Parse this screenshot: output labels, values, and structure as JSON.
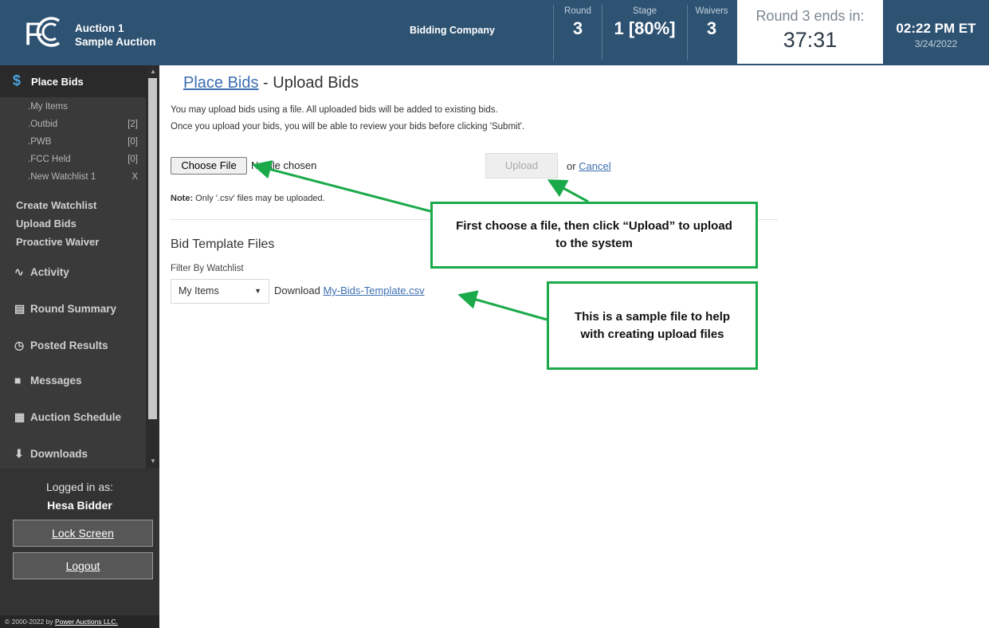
{
  "header": {
    "auction_line1": "Auction 1",
    "auction_line2": "Sample Auction",
    "company": "Bidding Company",
    "round_label": "Round",
    "round_value": "3",
    "stage_label": "Stage",
    "stage_value": "1 [80%]",
    "waivers_label": "Waivers",
    "waivers_value": "3",
    "timer_label": "Round 3 ends in:",
    "timer_value": "37:31",
    "clock_time": "02:22 PM ET",
    "clock_date": "3/24/2022"
  },
  "sidebar": {
    "place_bids": "Place Bids",
    "sub_items": [
      {
        "label": "My Items",
        "count": ""
      },
      {
        "label": "Outbid",
        "count": "[2]"
      },
      {
        "label": "PWB",
        "count": "[0]"
      },
      {
        "label": "FCC Held",
        "count": "[0]"
      },
      {
        "label": "New Watchlist 1",
        "count": "X"
      }
    ],
    "create_watchlist": "Create Watchlist",
    "upload_bids": "Upload Bids",
    "proactive_waiver": "Proactive Waiver",
    "nav": [
      "Activity",
      "Round Summary",
      "Posted Results",
      "Messages",
      "Auction Schedule",
      "Downloads"
    ],
    "logged_in_label": "Logged in as:",
    "user": "Hesa Bidder",
    "lock_screen": "Lock Screen",
    "logout": "Logout",
    "copyright_prefix": "© 2000-2022 by",
    "copyright_link": "Power Auctions LLC."
  },
  "main": {
    "title_link": "Place Bids",
    "title_rest": " - Upload Bids",
    "intro1": "You may upload bids using a file. All uploaded bids will be added to existing bids.",
    "intro2": "Once you upload your bids, you will be able to review your bids before clicking 'Submit'.",
    "choose_file": "Choose File",
    "no_file": "No file chosen",
    "upload": "Upload",
    "or": "or ",
    "cancel": "Cancel",
    "note_bold": "Note:",
    "note_text": " Only '.csv' files may be uploaded.",
    "template_title": "Bid Template Files",
    "filter_label": "Filter By Watchlist",
    "filter_value": "My Items",
    "download_prefix": "Download ",
    "download_link": "My-Bids-Template.csv"
  },
  "callouts": {
    "upload_tip": "First choose a file, then click “Upload” to upload to the system",
    "sample_tip": "This is a sample file to help with creating upload files"
  },
  "colors": {
    "header_bg": "#2e5272",
    "sidebar_bg": "#3a3a3a",
    "link": "#3c6fb0",
    "callout_border": "#1aaa4a"
  }
}
